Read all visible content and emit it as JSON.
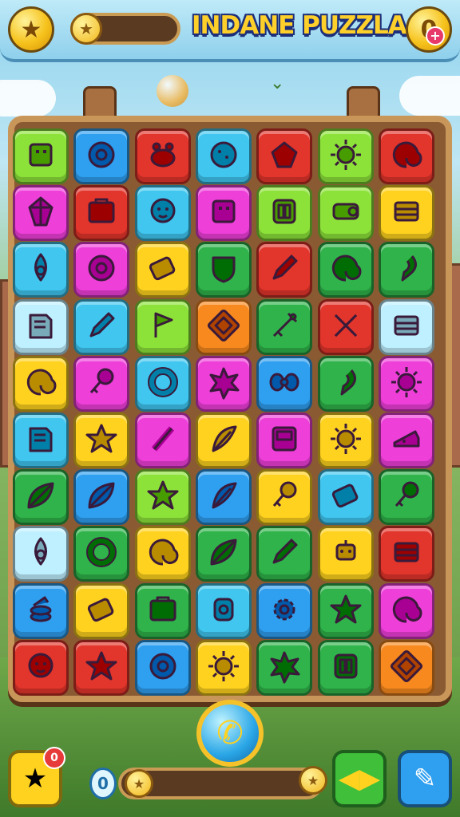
{
  "app": {
    "title": "INDANE PUZZLA"
  },
  "hud": {
    "star_icon": "star-icon",
    "progress_fraction": 0.2,
    "coin_icon": "coin-icon",
    "shop_badge": "+"
  },
  "colors": {
    "magenta": "#ee3fd9",
    "blue": "#2f9ff0",
    "red": "#e2352b",
    "cyan": "#40c6ef",
    "lime": "#8de23a",
    "yellow": "#ffd21f",
    "green": "#2fb34a",
    "orange": "#f7891f",
    "light": "#bff0ff"
  },
  "board": {
    "columns": 7,
    "rows": [
      [
        {
          "c": "lime",
          "i": "cube"
        },
        {
          "c": "blue",
          "i": "disc"
        },
        {
          "c": "red",
          "i": "pot"
        },
        {
          "c": "cyan",
          "i": "cookie"
        },
        {
          "c": "red",
          "i": "gem"
        },
        {
          "c": "lime",
          "i": "sun"
        },
        {
          "c": "red",
          "i": "swirl"
        }
      ],
      [
        {
          "c": "magenta",
          "i": "crystal"
        },
        {
          "c": "red",
          "i": "box"
        },
        {
          "c": "cyan",
          "i": "face"
        },
        {
          "c": "magenta",
          "i": "cube"
        },
        {
          "c": "lime",
          "i": "door"
        },
        {
          "c": "lime",
          "i": "log"
        },
        {
          "c": "yellow",
          "i": "crate"
        }
      ],
      [
        {
          "c": "cyan",
          "i": "drop"
        },
        {
          "c": "magenta",
          "i": "disc"
        },
        {
          "c": "yellow",
          "i": "battery"
        },
        {
          "c": "green",
          "i": "shield"
        },
        {
          "c": "red",
          "i": "pencil"
        },
        {
          "c": "green",
          "i": "swirl"
        },
        {
          "c": "green",
          "i": "hook"
        }
      ],
      [
        {
          "c": "light",
          "i": "book"
        },
        {
          "c": "cyan",
          "i": "pencil"
        },
        {
          "c": "lime",
          "i": "flag"
        },
        {
          "c": "orange",
          "i": "frame"
        },
        {
          "c": "green",
          "i": "sword"
        },
        {
          "c": "red",
          "i": "cross"
        },
        {
          "c": "light",
          "i": "crate"
        }
      ],
      [
        {
          "c": "yellow",
          "i": "swirl"
        },
        {
          "c": "magenta",
          "i": "key"
        },
        {
          "c": "cyan",
          "i": "ring"
        },
        {
          "c": "magenta",
          "i": "splat"
        },
        {
          "c": "blue",
          "i": "bow"
        },
        {
          "c": "green",
          "i": "hook"
        },
        {
          "c": "magenta",
          "i": "sun"
        }
      ],
      [
        {
          "c": "cyan",
          "i": "book"
        },
        {
          "c": "yellow",
          "i": "star"
        },
        {
          "c": "magenta",
          "i": "stick"
        },
        {
          "c": "yellow",
          "i": "feather"
        },
        {
          "c": "magenta",
          "i": "screen"
        },
        {
          "c": "yellow",
          "i": "sun"
        },
        {
          "c": "magenta",
          "i": "cheese"
        }
      ],
      [
        {
          "c": "green",
          "i": "leaf"
        },
        {
          "c": "blue",
          "i": "leaf"
        },
        {
          "c": "lime",
          "i": "star"
        },
        {
          "c": "blue",
          "i": "feather"
        },
        {
          "c": "yellow",
          "i": "key"
        },
        {
          "c": "cyan",
          "i": "battery"
        },
        {
          "c": "green",
          "i": "key"
        }
      ],
      [
        {
          "c": "light",
          "i": "drop"
        },
        {
          "c": "green",
          "i": "ring"
        },
        {
          "c": "yellow",
          "i": "swirl"
        },
        {
          "c": "green",
          "i": "leaf"
        },
        {
          "c": "green",
          "i": "pencil"
        },
        {
          "c": "yellow",
          "i": "robot"
        },
        {
          "c": "red",
          "i": "crate"
        }
      ],
      [
        {
          "c": "blue",
          "i": "stack"
        },
        {
          "c": "yellow",
          "i": "battery"
        },
        {
          "c": "green",
          "i": "box"
        },
        {
          "c": "cyan",
          "i": "can"
        },
        {
          "c": "blue",
          "i": "gear"
        },
        {
          "c": "green",
          "i": "star"
        },
        {
          "c": "magenta",
          "i": "swirl"
        }
      ],
      [
        {
          "c": "red",
          "i": "face"
        },
        {
          "c": "red",
          "i": "star"
        },
        {
          "c": "blue",
          "i": "disc"
        },
        {
          "c": "yellow",
          "i": "sun"
        },
        {
          "c": "green",
          "i": "splat"
        },
        {
          "c": "green",
          "i": "door"
        },
        {
          "c": "orange",
          "i": "frame"
        }
      ]
    ]
  },
  "bottom": {
    "left_button_icon": "megaphone-icon",
    "left_badge": "0",
    "counter_value": "0",
    "call_icon": "phone-icon",
    "bar_fraction": 0.0,
    "swap_icon": "swap-icon",
    "boost_icon": "pen-icon"
  }
}
